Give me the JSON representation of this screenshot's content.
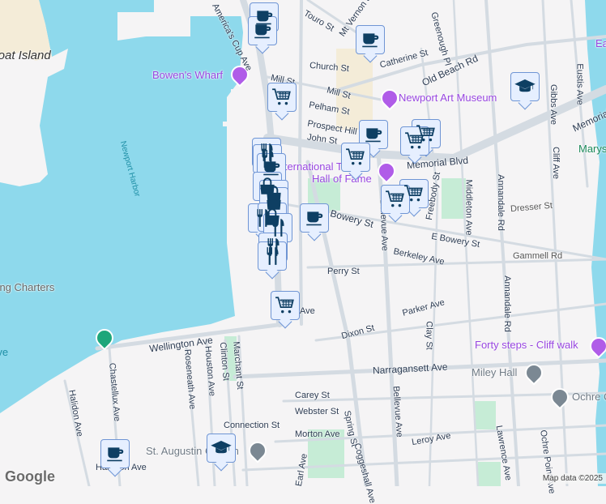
{
  "map": {
    "water_color": "#8ed9ec",
    "land_color": "#f5f4f5",
    "poi_color": "#9846e0",
    "marker_color": "#0e3f63",
    "islands": [
      "Goat Island"
    ],
    "water_labels": [
      "Newport Harbor",
      "Fishing Charters",
      "Ave"
    ],
    "pois": {
      "bowens_wharf": "Bowen's Wharf",
      "art_museum": "Newport Art Museum",
      "tennis_hof_1": "International Tennis",
      "tennis_hof_2": "Hall of Fame",
      "forty_steps": "Forty steps - Cliff walk",
      "miley_hall": "Miley Hall",
      "ochre_court": "Ochre Court",
      "st_augustin": "St. Augustin Church",
      "marys": "Marys",
      "east": "East"
    },
    "streets": {
      "touro": "Touro St",
      "mt_vernon": "Mt Vernon St",
      "americas_cup": "America's Cup Ave",
      "church": "Church St",
      "catherine": "Catherine St",
      "greenough": "Greenough Pl",
      "old_beach": "Old Beach Rd",
      "mill": "Mill St",
      "pelham": "Pelham St",
      "prospect_hill": "Prospect Hill St",
      "john": "John St",
      "memorial": "Memorial Blvd",
      "freebody": "Freebody St",
      "middleton": "Middleton Ave",
      "annandale": "Annandale Rd",
      "dresser": "Dresser St",
      "gibbs": "Gibbs Ave",
      "cliff": "Cliff Ave",
      "eustis": "Eustis Ave",
      "bowery": "Bowery St",
      "e_bowery": "E Bowery St",
      "bellevue": "Bellevue Ave",
      "berkeley": "Berkeley Ave",
      "gammell": "Gammell Rd",
      "perry": "Perry St",
      "parker": "Parker Ave",
      "dixon": "Dixon St",
      "clay": "Clay St",
      "narragansett": "Narragansett Ave",
      "ochre_point": "Ochre Point Ave",
      "spring": "Spring St",
      "carey": "Carey St",
      "webster": "Webster St",
      "morton": "Morton Ave",
      "leroy": "Leroy Ave",
      "lawrence": "Lawrence Ave",
      "coggeshall": "Coggeshall Ave",
      "wellington": "Wellington Ave",
      "chastellux": "Chastellux Ave",
      "halidon": "Halidon Ave",
      "roseneath": "Roseneath Ave",
      "houston": "Houston Ave",
      "clinton": "Clinton St",
      "marchant": "Marchant St",
      "connection": "Connection St",
      "harrison": "Harrison Ave",
      "earl": "Earl Ave"
    },
    "markers": [
      "coffee-icon",
      "shopping-cart-icon",
      "restaurant-icon",
      "shopping-bag-icon",
      "graduation-cap-icon"
    ],
    "google_logo": "Google",
    "attribution": "Map data ©2025"
  }
}
